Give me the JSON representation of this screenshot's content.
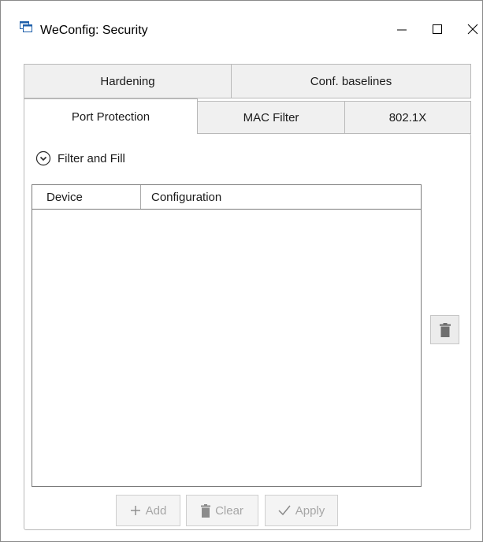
{
  "window": {
    "title": "WeConfig: Security",
    "controls": {
      "minimize": "—",
      "maximize": "☐",
      "close": "✕"
    }
  },
  "tabs": {
    "row1": [
      {
        "label": "Hardening"
      },
      {
        "label": "Conf. baselines"
      }
    ],
    "row2": [
      {
        "label": "Port Protection",
        "selected": true
      },
      {
        "label": "MAC Filter"
      },
      {
        "label": "802.1X"
      }
    ]
  },
  "expander": {
    "label": "Filter and Fill",
    "icon": "chevron-down-circle-icon"
  },
  "grid": {
    "columns": [
      "Device",
      "Configuration"
    ],
    "rows": []
  },
  "side_actions": {
    "delete_icon": "trash-icon"
  },
  "actions": {
    "add": "Add",
    "clear": "Clear",
    "apply": "Apply"
  },
  "colors": {
    "border": "#b9b9b9",
    "tab_inactive_bg": "#f0f0f0",
    "disabled_text": "#a6a6a6",
    "icon_gray": "#7b7b7b"
  }
}
